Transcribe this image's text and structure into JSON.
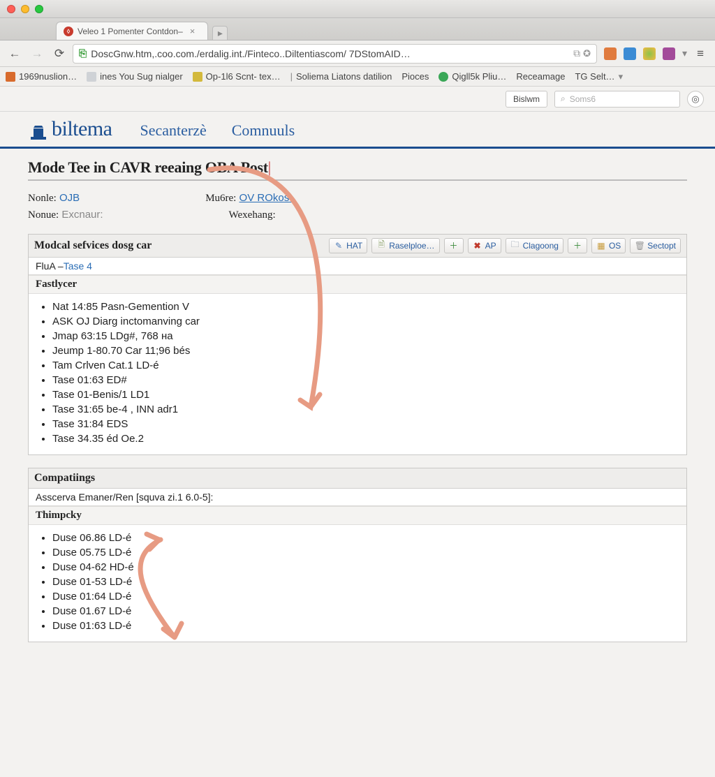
{
  "tab": {
    "title": "Veleo 1 Pomenter Contdon–"
  },
  "url": "DoscGnw.htm,.coo.com./erdalig.int./Finteco..Diltentiascom/ 7DStomAID…",
  "bookmarks": [
    {
      "label": "1969nuslion…",
      "color": "#d86b2d"
    },
    {
      "label": "ines You Sug nialger",
      "color": "#9aa0a6"
    },
    {
      "label": "Op-1l6 Scnt- tex…",
      "color": "#d3b93c"
    },
    {
      "label": "Soliema Liatons datilion",
      "color": ""
    },
    {
      "label": "Pioces",
      "color": ""
    },
    {
      "label": "Qigll5k Pliu…",
      "color": "#3aa757"
    },
    {
      "label": "Receamage",
      "color": ""
    },
    {
      "label": "TG Selt…",
      "color": ""
    }
  ],
  "headerbar": {
    "btn": "Bislwm",
    "search_placeholder": "Soms6"
  },
  "nav": {
    "brand": "biltema",
    "item1": "Secanterzè",
    "item2": "Comnuuls"
  },
  "page_title": "Mode Tee in CAVR reeaing OBA Post",
  "meta": {
    "norle_label": "Nonle:",
    "norle_val": "OJB",
    "none_label": "Nonue:",
    "none_val": "Excnaur:",
    "mubre_label": "Mu6re:",
    "mubre_val": "OV ROkost.",
    "wex_label": "Wexehang:",
    "wex_val": ""
  },
  "panel1": {
    "title": "Modcal sefvices dosg car",
    "buttons": [
      {
        "icon": "pencil",
        "label": "HAT"
      },
      {
        "icon": "page",
        "label": "Raselploe…"
      },
      {
        "icon": "plus",
        "label": ""
      },
      {
        "icon": "x",
        "label": "AP"
      },
      {
        "icon": "clip",
        "label": "Clagoong"
      },
      {
        "icon": "plus2",
        "label": ""
      },
      {
        "icon": "box",
        "label": "OS"
      },
      {
        "icon": "trash",
        "label": "Sectopt"
      }
    ],
    "sub_prefix": "FluA  –",
    "sub_link": "Tase 4",
    "section": "Fastlycer",
    "items": [
      "Nat 14:85 Pasn-Gemention V",
      "ASK OJ Diarg inctomanving car",
      "Jmap 63:15 LDg#, 768 на",
      "Jeump 1-80.70 Car 11;96 bés",
      "Tam Crlven Cat.1 LD-é",
      "Tase 01:63 ED#",
      "Tase 01-Benis/1 LD1",
      "Tase 31:65 be-4 , INN adr1",
      "Tase 31:84 EDS",
      "Tase 34.35 éd Oe.2"
    ]
  },
  "panel2": {
    "title": "Compatiings",
    "sub": "Asscerva Emaner/Ren [squva zi.1 6.0-5]:",
    "section": "Thimpcky",
    "items": [
      "Duse 06.86 LD-é",
      "Duse 05.75 LD-é",
      "Duse 04-62 HD-é",
      "Duse 01-53 LD-é",
      "Duse 01:64 LD-é",
      "Duse 01.67 LD-é",
      "Duse 01:63 LD-é"
    ]
  }
}
